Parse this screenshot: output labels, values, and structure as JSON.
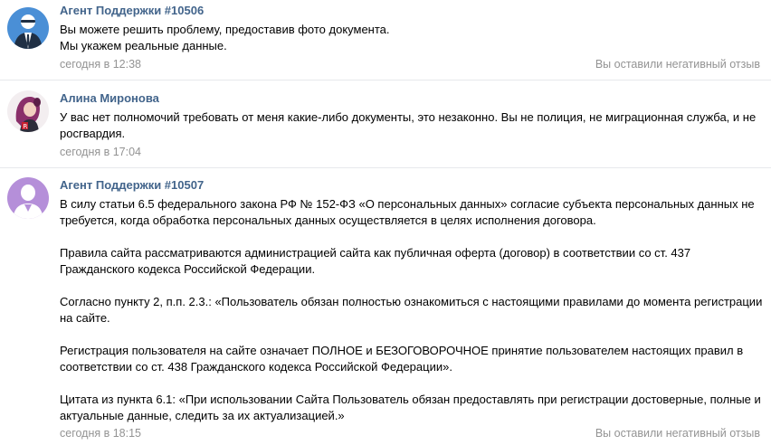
{
  "messages": [
    {
      "author": "Агент Поддержки #10506",
      "avatar_icon": "agent-suit-avatar-icon",
      "lines": [
        "Вы можете решить проблему, предоставив фото документа.",
        "Мы укажем реальные данные."
      ],
      "time": "сегодня в 12:38",
      "note": "Вы оставили негативный отзыв"
    },
    {
      "author": "Алина Миронова",
      "avatar_icon": "user-photo-avatar-icon",
      "lines": [
        "У вас нет полномочий требовать от меня какие-либо документы, это незаконно. Вы не полиция, не миграционная служба, и не росгвардия."
      ],
      "time": "сегодня в 17:04"
    },
    {
      "author": "Агент Поддержки #10507",
      "avatar_icon": "default-user-silhouette-icon",
      "paragraphs": [
        "В силу статьи 6.5 федерального закона РФ № 152-ФЗ «О персональных данных» согласие субъекта персональных данных не требуется, когда обработка персональных данных осуществляется в целях исполнения договора.",
        "Правила сайта рассматриваются администрацией сайта как публичная оферта (договор) в соответствии со ст. 437 Гражданского кодекса Российской Федерации.",
        "Согласно пункту 2, п.п. 2.3.: «Пользователь обязан полностью ознакомиться с настоящими правилами до момента регистрации на сайте.",
        "Регистрация пользователя на сайте означает ПОЛНОЕ и БЕЗОГОВОРОЧНОЕ принятие пользователем настоящих правил в соответствии со ст. 438 Гражданского кодекса Российской Федерации».",
        "Цитата из пункта 6.1: «При использовании Сайта Пользователь обязан предоставлять при регистрации достоверные, полные и актуальные данные, следить за их актуализацией.»"
      ],
      "time": "сегодня в 18:15",
      "note": "Вы оставили негативный отзыв"
    }
  ],
  "colors": {
    "author": "#42648b",
    "meta": "#939393",
    "separator": "#e7e8ec"
  }
}
